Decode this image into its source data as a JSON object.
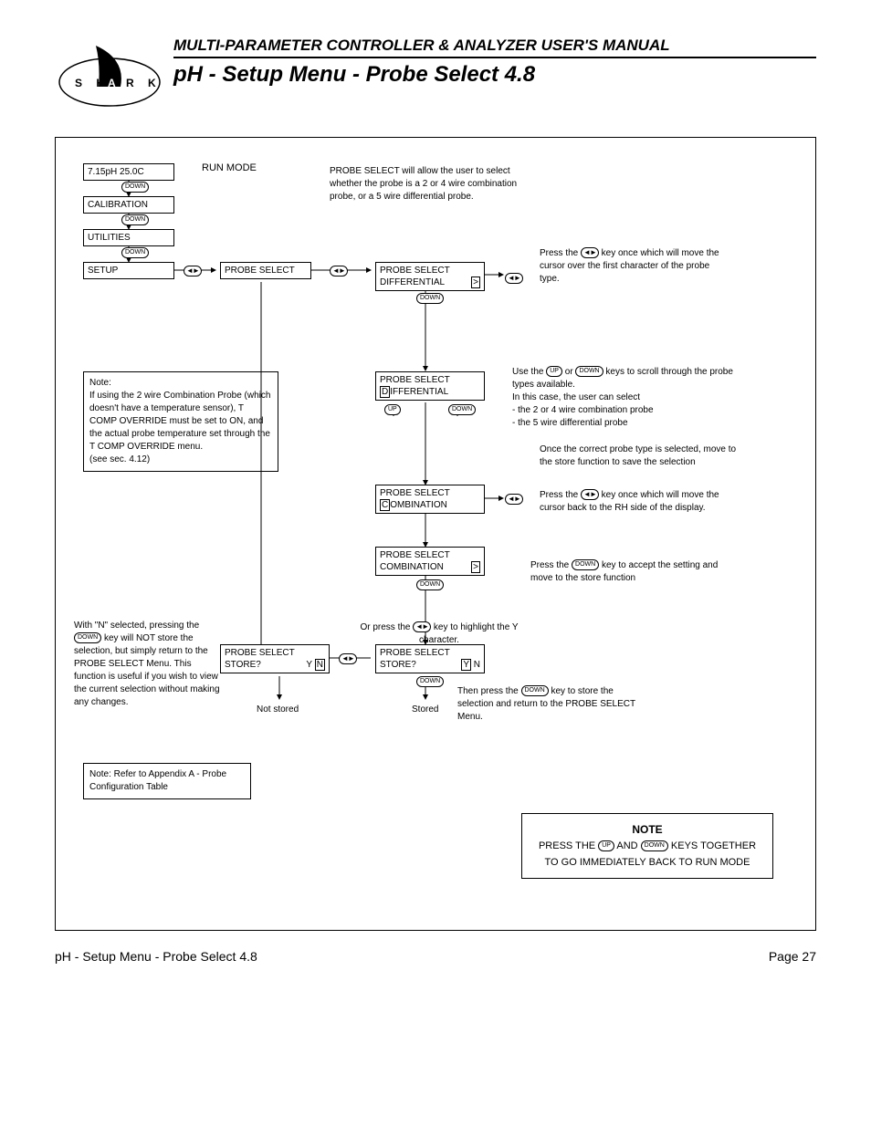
{
  "header": {
    "manual_title": "MULTI-PARAMETER CONTROLLER & ANALYZER USER'S MANUAL",
    "section_title": "pH - Setup Menu - Probe Select 4.8",
    "logo_letters": "S H A R K"
  },
  "flow": {
    "run_mode_label": "RUN MODE",
    "lcd_start": "7.15pH   25.0C",
    "lcd_calibration": "CALIBRATION",
    "lcd_utilities": "UTILITIES",
    "lcd_setup": "SETUP",
    "lcd_probe_select": "PROBE SELECT",
    "lcd_ps_diff": {
      "line1": "PROBE SELECT",
      "line2": "DIFFERENTIAL",
      "cursor": ">"
    },
    "lcd_ps_diff_cur": {
      "line1": "PROBE SELECT",
      "line2_pre": "D",
      "line2_rest": "IFFERENTIAL"
    },
    "lcd_ps_comb_cur": {
      "line1": "PROBE SELECT",
      "line2_pre": "C",
      "line2_rest": "OMBINATION"
    },
    "lcd_ps_comb": {
      "line1": "PROBE SELECT",
      "line2": "COMBINATION",
      "cursor": ">"
    },
    "lcd_store_yn_n": {
      "line1": "PROBE SELECT",
      "line2": "STORE?",
      "y": "Y",
      "n": "N"
    },
    "lcd_store_yn_y": {
      "line1": "PROBE SELECT",
      "line2": "STORE?",
      "y": "Y",
      "n": "N"
    },
    "stored_label": "Stored",
    "not_stored_label": "Not stored"
  },
  "keys": {
    "up": "UP",
    "down": "DOWN",
    "lr": "◄►"
  },
  "text": {
    "intro": "PROBE SELECT will allow the user to select whether the probe is a 2 or 4 wire combination probe, or a 5 wire differential probe.",
    "press_lr_once": "key once which will move the cursor over the first character of the probe type.",
    "press_lr_prefix": "Press the",
    "scroll_prefix": "Use the",
    "scroll_mid": "or",
    "scroll_suffix": "keys to scroll through the probe types available.",
    "scroll_body": "In this case, the user can select",
    "scroll_opt1": "- the 2 or 4 wire combination probe",
    "scroll_opt2": "- the 5 wire differential probe",
    "once_correct": "Once the correct probe type is selected, move to the store function to save the selection",
    "lr_back": "key once which will move the cursor back to the RH side of the display.",
    "press_down_accept_pre": "Press the",
    "press_down_accept_post": "key to accept the setting and move to the store function",
    "or_press_lr": "Or press the",
    "or_press_lr_post": "key to highlight the Y character.",
    "then_press_pre": "Then press the",
    "then_press_post": "key to store the selection and return to the PROBE SELECT Menu.",
    "n_selected_pre": "With \"N\" selected, pressing the",
    "n_selected_post": "key will NOT store the selection, but simply return to the PROBE SELECT Menu. This function is useful if you wish to view the current selection without making any changes.",
    "note1_title": "Note:",
    "note1_body": "If using the 2 wire Combination Probe (which doesn't have a temperature sensor), T COMP OVERRIDE must be set to ON, and the actual probe temperature set through the T COMP OVERRIDE menu.",
    "note1_ref": "(see sec. 4.12)",
    "note2": "Note: Refer to Appendix A - Probe Configuration Table",
    "note_big_title": "NOTE",
    "note_big_pre": "PRESS THE",
    "note_big_mid": "AND",
    "note_big_post": "KEYS TOGETHER TO GO IMMEDIATELY BACK TO RUN MODE"
  },
  "footer": {
    "left": "pH - Setup Menu - Probe Select 4.8",
    "right": "Page 27"
  }
}
